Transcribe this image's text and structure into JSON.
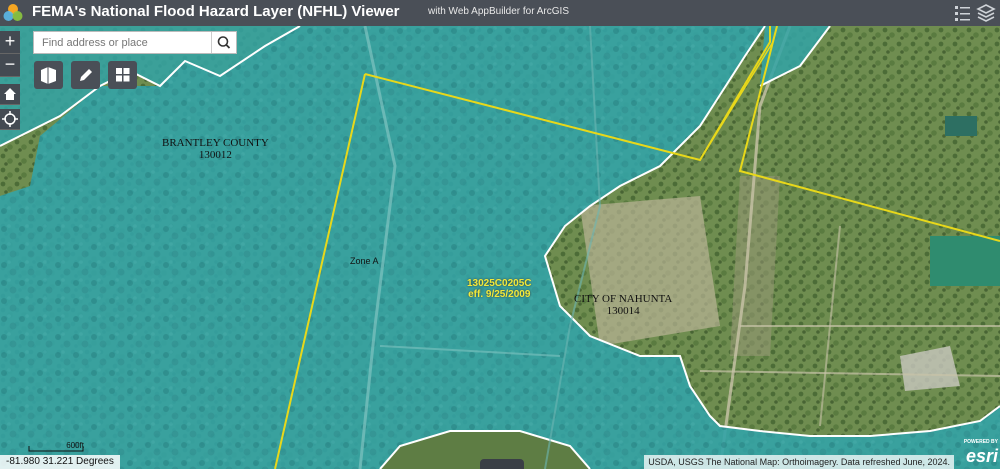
{
  "header": {
    "title": "FEMA's National Flood Hazard Layer (NFHL) Viewer",
    "subtitle": "with Web AppBuilder for ArcGIS",
    "icons": [
      "app-logo-icon",
      "list-icon",
      "layers-icon"
    ]
  },
  "search": {
    "placeholder": "Find address or place",
    "value": ""
  },
  "toolbar": {
    "icons": [
      "zoom-in-icon",
      "zoom-out-icon",
      "home-icon",
      "locate-icon",
      "basemap-icon",
      "edit-icon",
      "grid-icon",
      "search-icon"
    ]
  },
  "zoom": {
    "in_label": "+",
    "out_label": "−"
  },
  "map": {
    "labels": {
      "brantley": "BRANTLEY COUNTY",
      "brantley_id": "130012",
      "nahunta": "CITY OF NAHUNTA",
      "nahunta_id": "130014",
      "zone": "Zone A",
      "panel": "13025C0205C",
      "panel_eff": "eff. 9/25/2009"
    },
    "colors": {
      "flood_zone": "#33a3a6",
      "boundary": "#e8d81a",
      "land": "#6e8f4e"
    }
  },
  "footer": {
    "coordinates": "-81.980 31.221 Degrees",
    "scale": "600ft",
    "attribution": "USDA, USGS The National Map: Orthoimagery. Data refreshed June, 2024.",
    "esri_powered": "POWERED BY",
    "esri": "esri"
  }
}
